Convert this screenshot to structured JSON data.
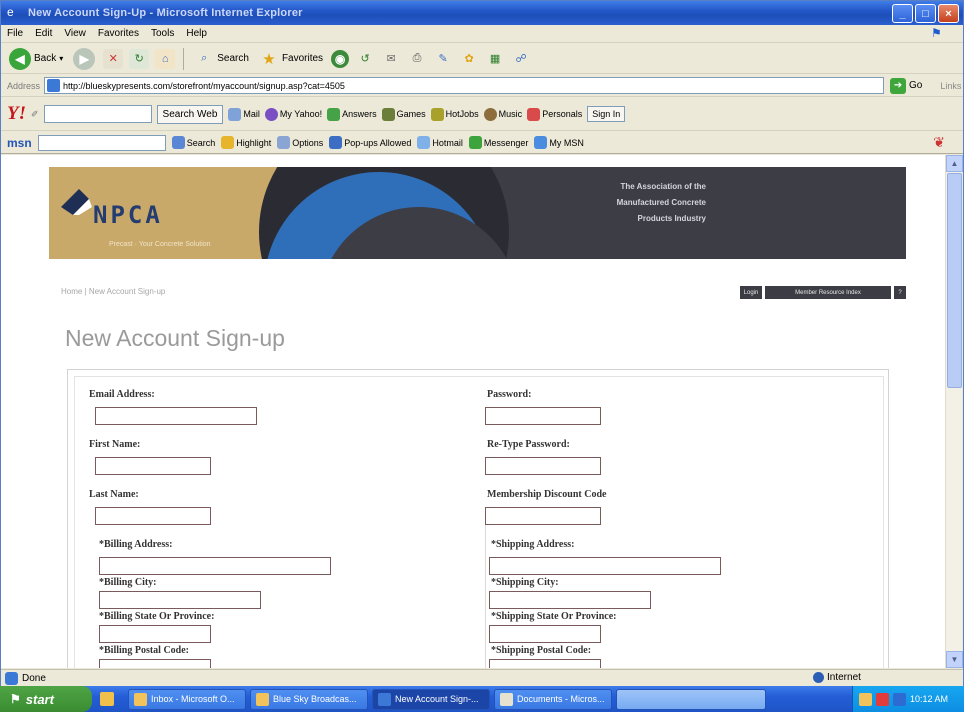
{
  "window": {
    "title": "New Account Sign-Up - Microsoft Internet Explorer",
    "controls": [
      "_",
      "□",
      "×"
    ]
  },
  "menu": [
    "File",
    "Edit",
    "View",
    "Favorites",
    "Tools",
    "Help"
  ],
  "toolbar": {
    "back": "Back",
    "search": "Search",
    "favorites": "Favorites"
  },
  "address": {
    "label": "Address",
    "url": "http://blueskypresents.com/storefront/myaccount/signup.asp?cat=4505",
    "go": "Go",
    "links": "Links"
  },
  "yahoo": {
    "logo": "Y!",
    "search_btn": "Search Web",
    "items": [
      "Mail",
      "My Yahoo!",
      "Answers",
      "Games",
      "HotJobs",
      "Music",
      "Personals"
    ],
    "signin": "Sign In"
  },
  "msn": {
    "logo": "msn",
    "items": [
      "Search",
      "Highlight",
      "Options",
      "Pop-ups Allowed",
      "Hotmail",
      "Messenger",
      "My MSN"
    ]
  },
  "banner": {
    "logo": "NPCA",
    "tagline": "Precast · Your Concrete Solution",
    "assoc_lines": [
      "The Association of the",
      "Manufactured Concrete",
      "Products Industry"
    ]
  },
  "breadcrumb": "Home | New Account Sign-up",
  "top_buttons": [
    "Login",
    "Member Resource Index",
    "?"
  ],
  "page_title": "New Account Sign-up",
  "form": {
    "email": "Email Address:",
    "password": "Password:",
    "first_name": "First Name:",
    "retype_password": "Re-Type Password:",
    "last_name": "Last Name:",
    "membership_code": "Membership Discount Code",
    "billing_address": "*Billing Address:",
    "billing_city": "*Billing City:",
    "billing_state": "*Billing State Or Province:",
    "billing_postal": "*Billing Postal Code:",
    "shipping_address": "*Shipping Address:",
    "shipping_city": "*Shipping City:",
    "shipping_state": "*Shipping State Or Province:",
    "shipping_postal": "*Shipping Postal Code:"
  },
  "status": {
    "text": "Done",
    "zone": "Internet"
  },
  "taskbar": {
    "start": "start",
    "items": [
      "Inbox - Microsoft O...",
      "Blue Sky Broadcas...",
      "New Account Sign-...",
      "Documents - Micros..."
    ],
    "clock": "10:12 AM"
  },
  "colors": {
    "banner_tan": "#c9a96a",
    "banner_dark": "#3d3d46",
    "banner_blue": "#2f6fb9",
    "logo_navy": "#243c70",
    "title_gray": "#9a9a9a"
  }
}
